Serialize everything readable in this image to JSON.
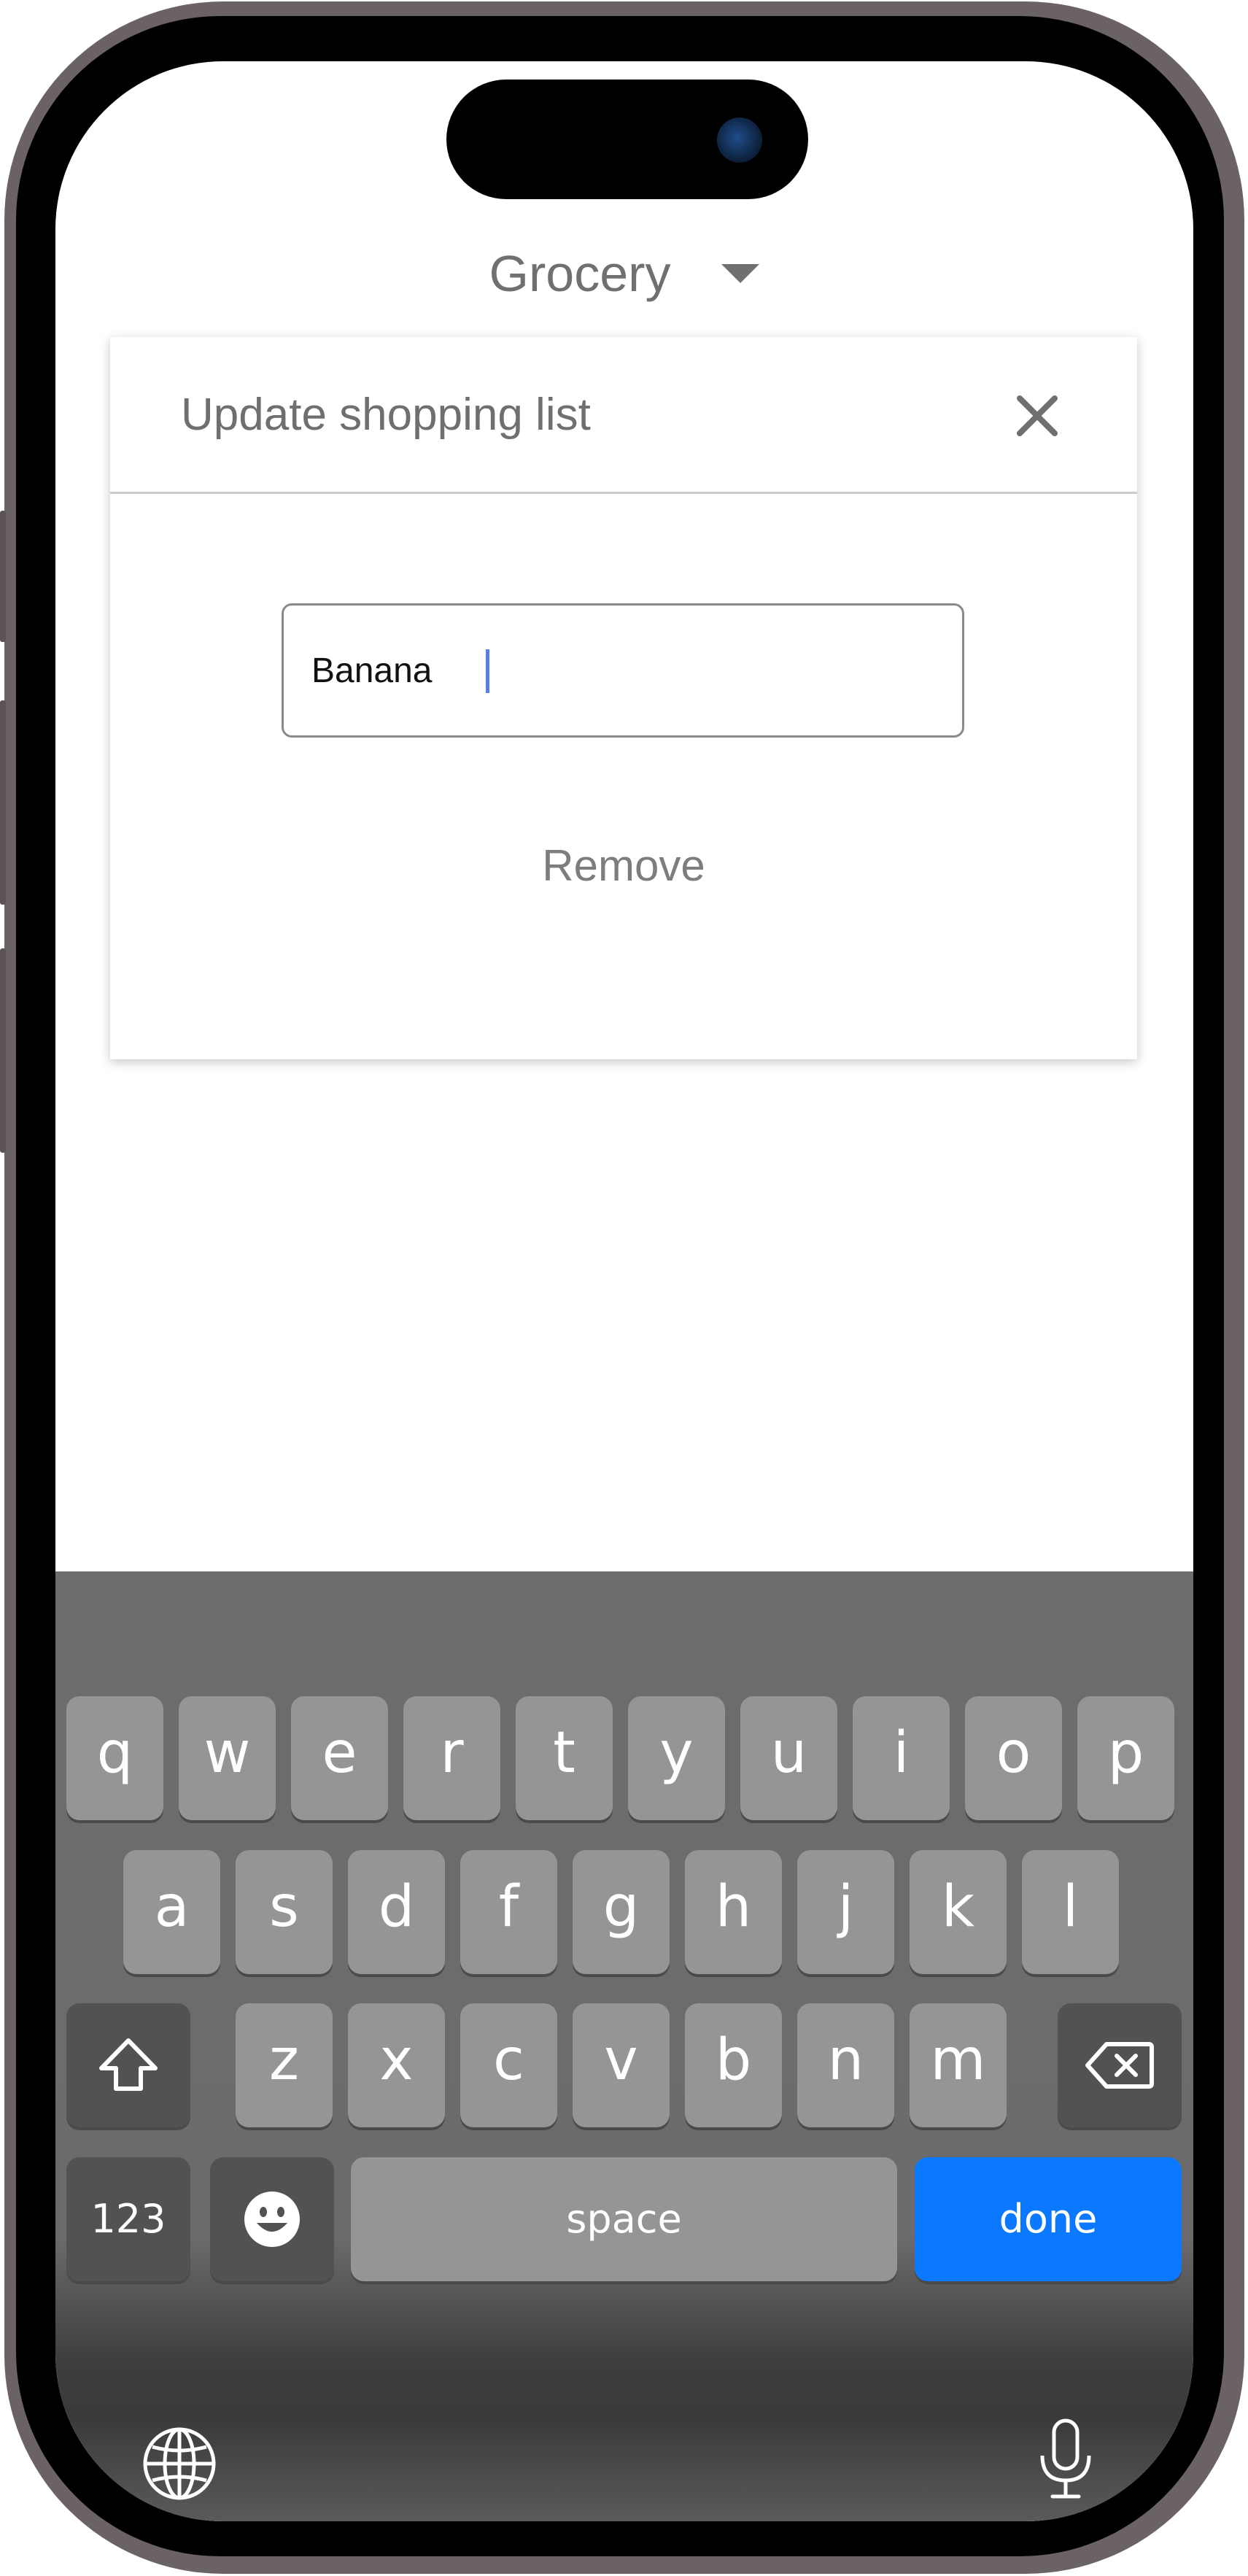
{
  "header": {
    "title": "Grocery",
    "dropdown_icon": "caret-down-icon"
  },
  "dialog": {
    "title": "Update shopping list",
    "close_icon": "close-icon",
    "input_value": "Banana",
    "remove_label": "Remove"
  },
  "keyboard": {
    "row1": [
      "q",
      "w",
      "e",
      "r",
      "t",
      "y",
      "u",
      "i",
      "o",
      "p"
    ],
    "row2": [
      "a",
      "s",
      "d",
      "f",
      "g",
      "h",
      "j",
      "k",
      "l"
    ],
    "row3": [
      "z",
      "x",
      "c",
      "v",
      "b",
      "n",
      "m"
    ],
    "shift_icon": "shift-icon",
    "backspace_icon": "backspace-icon",
    "numbers_label": "123",
    "emoji_icon": "emoji-icon",
    "space_label": "space",
    "done_label": "done",
    "globe_icon": "globe-icon",
    "mic_icon": "microphone-icon"
  },
  "colors": {
    "done_key": "#0a78ff",
    "key": "#959595",
    "dark_key": "#525252",
    "phone_frame": "#6b6264"
  }
}
